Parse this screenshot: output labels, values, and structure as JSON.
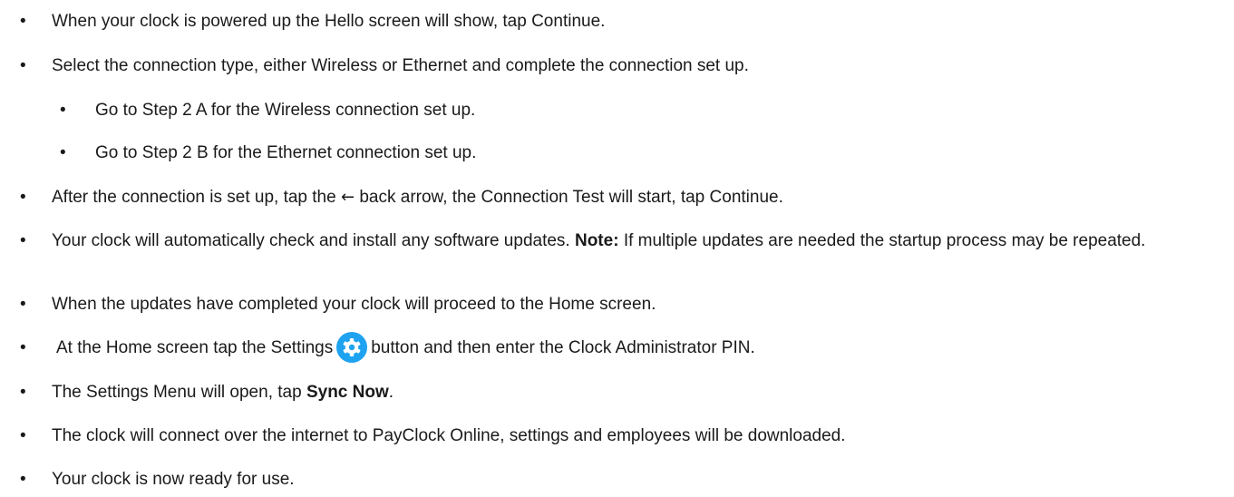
{
  "steps": [
    {
      "text": "When your clock is powered up the Hello screen will show, tap Continue."
    },
    {
      "text": "Select the connection type, either Wireless or Ethernet and complete the connection set up."
    },
    {
      "text": "Go to Step 2 A for the Wireless connection set up."
    },
    {
      "text": "Go to Step 2 B for the Ethernet connection set up."
    },
    {
      "before": "After the connection is set up, tap the",
      "arrow": "←",
      "after": "back arrow, the Connection Test will start, tap Continue."
    },
    {
      "before": "Your clock will automatically check and install any software updates.",
      "bold": "Note:",
      "after": "If multiple updates are needed the startup process may be repeated."
    },
    {
      "text": "When the updates have completed your clock will proceed to the Home screen."
    },
    {
      "before": "At the Home screen tap the Settings",
      "icon": "settings-gear-icon",
      "after": "button and then enter the Clock Administrator PIN."
    },
    {
      "before": "The Settings Menu will open, tap",
      "bold": "Sync Now",
      "after": "."
    },
    {
      "text": "The clock will connect over the internet to PayClock Online, settings and employees will be downloaded."
    },
    {
      "text": "Your clock is now ready for use."
    }
  ],
  "bullet_char": "•",
  "colors": {
    "icon_blue": "#1fa3f0",
    "text": "#1a1a1a"
  }
}
